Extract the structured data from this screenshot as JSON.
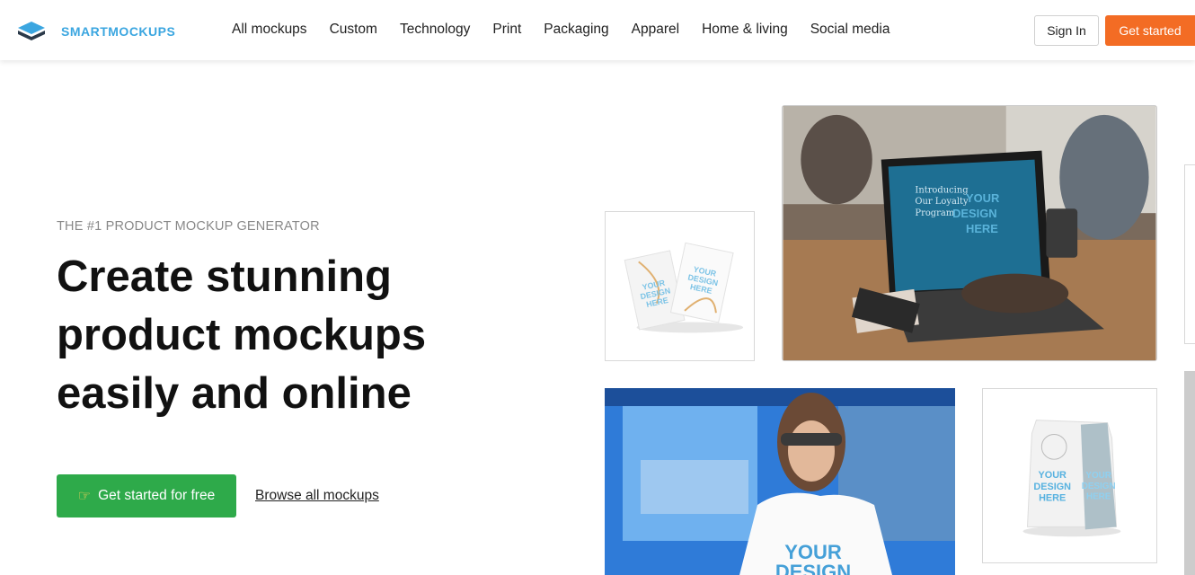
{
  "brand": {
    "name": "SMARTMOCKUPS",
    "accent": "#3ba6e0"
  },
  "nav": {
    "items": [
      "All mockups",
      "Custom",
      "Technology",
      "Print",
      "Packaging",
      "Apparel",
      "Home & living",
      "Social media"
    ]
  },
  "header": {
    "sign_in": "Sign In",
    "get_started": "Get started",
    "get_started_color": "#f36c24"
  },
  "hero": {
    "eyebrow": "THE #1 PRODUCT MOCKUP GENERATOR",
    "headline_lines": [
      "Create stunning",
      "product mockups",
      "easily and online"
    ],
    "cta_label": "Get started for free",
    "cta_icon": "pointing-hand-icon",
    "cta_color": "#2eaa4a",
    "browse_label": "Browse all mockups"
  },
  "mockups": {
    "packets_text": "YOUR DESIGN HERE",
    "laptop_screen_lines": [
      "Introducing",
      "Our Loyalty",
      "Program"
    ],
    "laptop_overlay": "YOUR DESIGN HERE",
    "tshirt_text": "YOUR DESIGN",
    "bag_text": "YOUR DESIGN HERE"
  }
}
